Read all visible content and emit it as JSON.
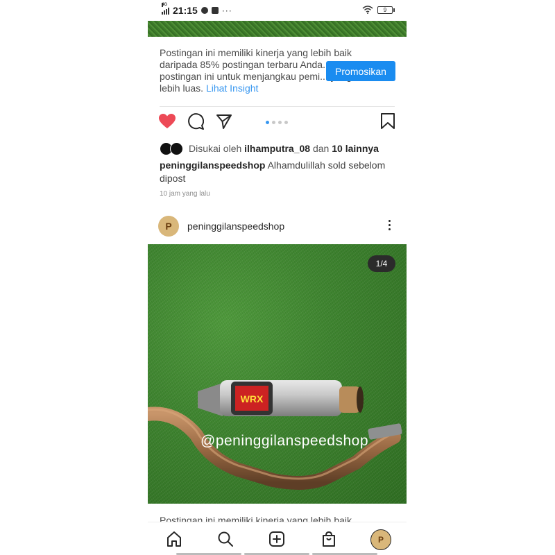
{
  "status_bar": {
    "network": "4G",
    "time": "21:15",
    "battery": "9"
  },
  "top_post": {
    "insight_text": "Postingan ini memiliki kinerja yang lebih baik daripada 85% postingan terbaru Anda. postingan ini untuk menjangkau pemi... yang lebih luas.",
    "insight_link": "Lihat Insight",
    "promote_button": "Promosikan",
    "carousel": {
      "count": 4,
      "active_index": 0
    },
    "likes_prefix": "Disukai oleh",
    "likes_user": "ilhamputra_08",
    "likes_conj": "dan",
    "likes_others": "10 lainnya",
    "caption_user": "peninggilanspeedshop",
    "caption_text": "Alhamdulillah sold sebelom dipost",
    "time_ago": "10 jam yang lalu"
  },
  "next_post": {
    "username": "peninggilanspeedshop",
    "avatar_letter": "P",
    "image_counter": "1/4",
    "watermark": "@peninggilanspeedshop",
    "insight_text": "Postingan ini memiliki kinerja yang lebih baik"
  },
  "nav": {
    "items": [
      "home-icon",
      "search-icon",
      "add-post-icon",
      "shop-icon",
      "profile-avatar"
    ],
    "avatar_letter": "P"
  },
  "colors": {
    "like_red": "#ed4956",
    "accent_blue": "#3897f0",
    "button_blue": "#1a8cf0"
  }
}
